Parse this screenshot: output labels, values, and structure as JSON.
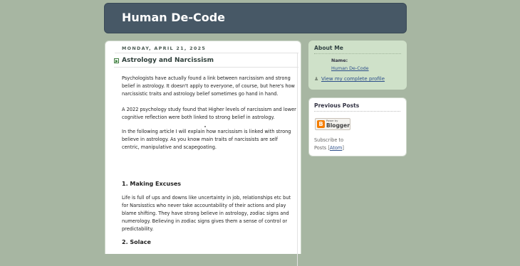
{
  "header": {
    "title": "Human De-Code"
  },
  "post": {
    "date": "MONDAY, APRIL 21, 2025",
    "title": "Astrology and Narcissism",
    "paragraphs": [
      "Psychologists have actually found a link between narcissism and strong belief in astrology. It doesn't apply to everyone, of course, but here's how narcissistic traits and astrology belief sometimes go hand in hand.",
      "A 2022 psychology study found that Higher levels of narcissism and lower cognitive reflection were both linked to strong belief in astrology.",
      "In the following article I will explain how narcissism is linked with strong believe in astrology. As you know main traits of narcissists are self centric, manipulative and scapegoating.",
      "Life is full of ups and downs like uncertainty in job, relationships etc but for Narsisstics who never take accountability of their actions and play blame shifting. They have strong believe in astrology, zodiac signs and numerology. Believing in zodiac signs gives them a sense of control or predictability."
    ],
    "headings": [
      "1. Making Excuses",
      "2. Solace"
    ]
  },
  "sidebar": {
    "about": {
      "title": "About Me",
      "name_label": "Name:",
      "name": "Human De-Code",
      "profile_link": "View my complete profile"
    },
    "previous": {
      "title": "Previous Posts",
      "badge_small": "Power by",
      "badge_big": "Blogger",
      "subscribe_text": "Subscribe to",
      "posts_text": "Posts",
      "atom": "Atom"
    }
  },
  "colors": {
    "background": "#a7b6a2",
    "header": "#475866",
    "link": "#2d4f8a",
    "about_bg": "#cfe1c9"
  },
  "icons": [
    "post-arrow-icon",
    "profile-icon",
    "blogger-icon"
  ]
}
